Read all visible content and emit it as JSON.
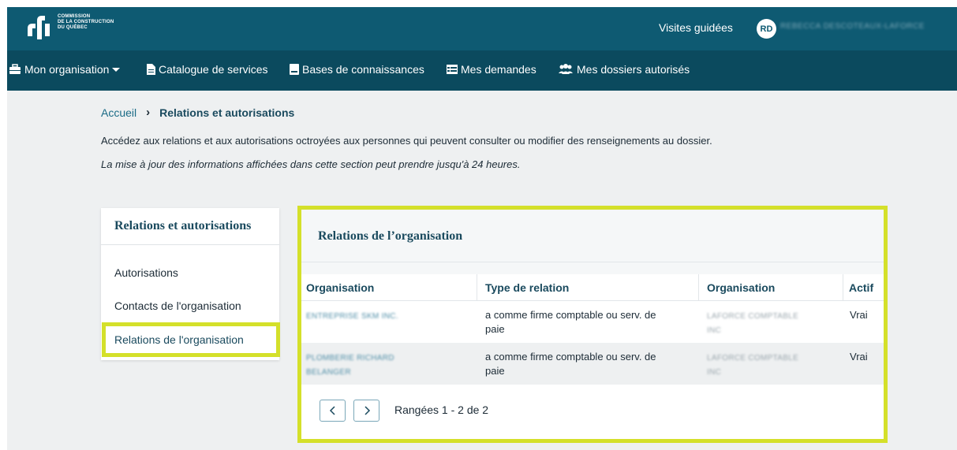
{
  "brand": {
    "name_line1": "COMMISSION",
    "name_line2": "DE LA CONSTRUCTION",
    "name_line3": "DU QUÉBEC"
  },
  "topbar": {
    "guided_tours": "Visites guidées",
    "avatar_initials": "RD",
    "user_name": "REBECCA DESCOTEAUX-LAFORCE"
  },
  "nav": {
    "items": [
      {
        "label": "Mon organisation",
        "icon": "briefcase-icon"
      },
      {
        "label": "Catalogue de services",
        "icon": "document-icon"
      },
      {
        "label": "Bases de connaissances",
        "icon": "book-icon"
      },
      {
        "label": "Mes demandes",
        "icon": "list-icon"
      },
      {
        "label": "Mes dossiers autorisés",
        "icon": "users-icon"
      }
    ]
  },
  "breadcrumb": {
    "home": "Accueil",
    "current": "Relations et autorisations"
  },
  "intro": {
    "text": "Accédez aux relations et aux autorisations octroyées aux personnes qui peuvent consulter ou modifier des renseignements au dossier.",
    "note": "La mise à jour des informations affichées dans cette section peut prendre jusqu'à 24 heures."
  },
  "sidebar": {
    "title": "Relations et autorisations",
    "items": [
      {
        "label": "Autorisations"
      },
      {
        "label": "Contacts de l'organisation"
      },
      {
        "label": "Relations de l'organisation"
      }
    ]
  },
  "panel": {
    "title": "Relations de l’organisation",
    "columns": [
      "Organisation",
      "Type de relation",
      "Organisation",
      "Actif"
    ],
    "rows": [
      {
        "org": "ENTREPRISE SKM INC.",
        "type_line1": "a comme firme comptable ou serv. de",
        "type_line2": "paie",
        "org2_line1": "LAFORCE COMPTABLE",
        "org2_line2": "INC",
        "active": "Vrai"
      },
      {
        "org_line1": "PLOMBERIE RICHARD",
        "org_line2": "BELANGER",
        "type_line1": "a comme firme comptable ou serv. de",
        "type_line2": "paie",
        "org2_line1": "LAFORCE COMPTABLE",
        "org2_line2": "INC",
        "active": "Vrai"
      }
    ],
    "range": "Rangées 1 - 2 de 2"
  },
  "colors": {
    "topbar": "#0e5a72",
    "navbar": "#0b4a5e",
    "highlight": "#d4e02a",
    "link": "#1a6b86"
  }
}
